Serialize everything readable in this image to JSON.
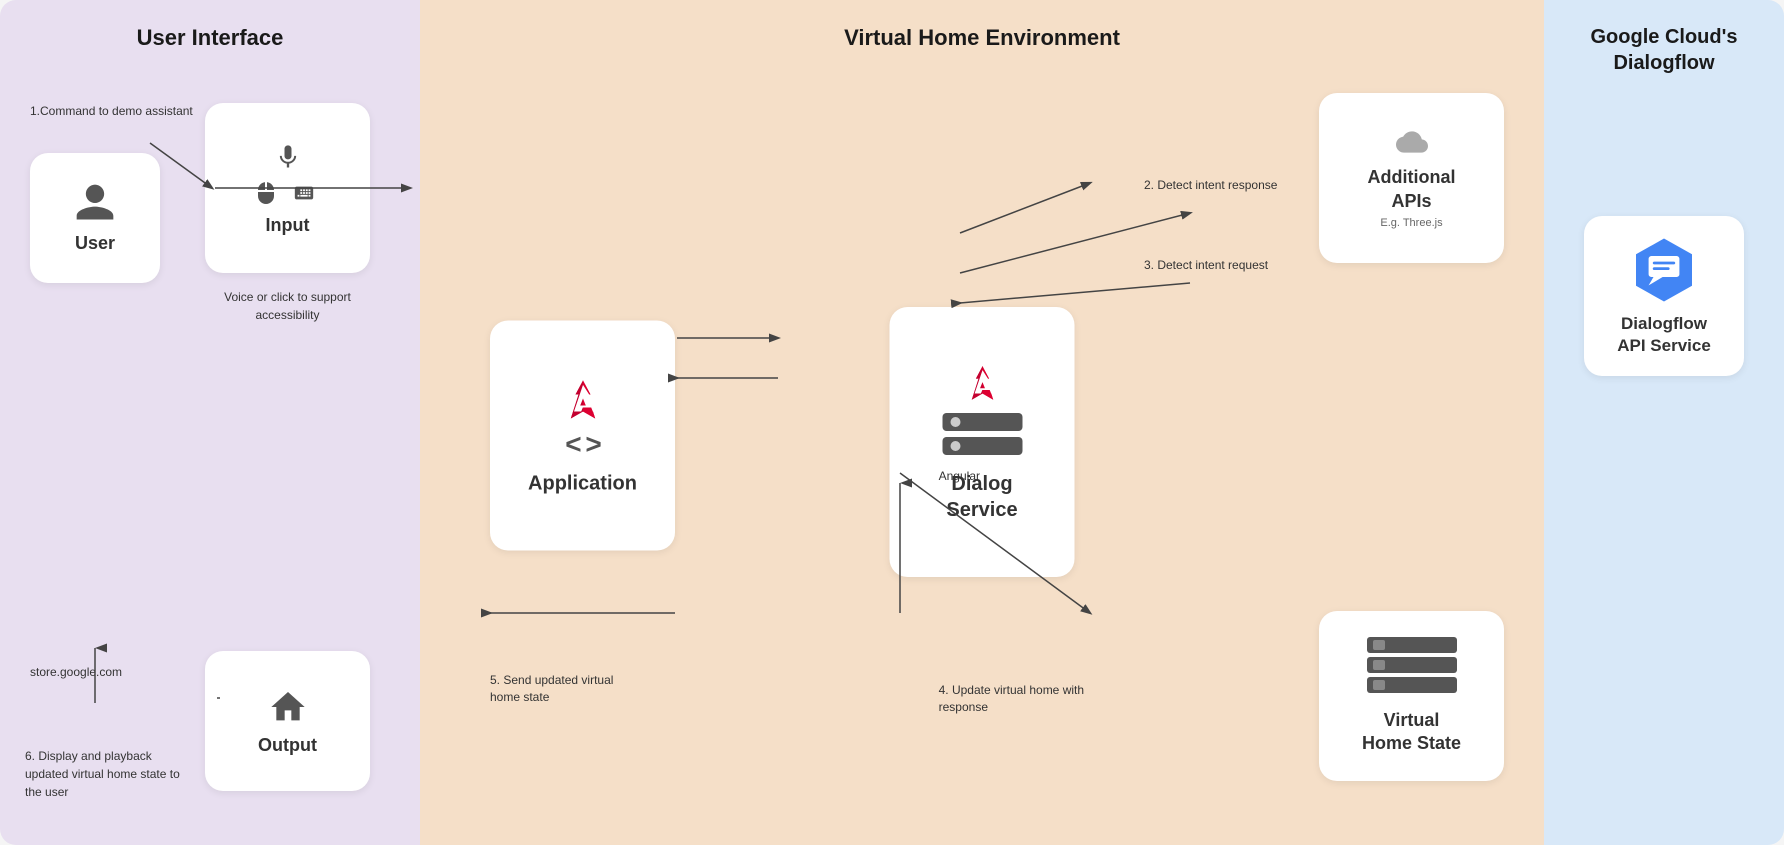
{
  "sections": {
    "ui": {
      "title": "User Interface",
      "user_label": "User",
      "input_label": "Input",
      "output_label": "Output",
      "input_description": "Voice or click to\nsupport accessibility",
      "command_text": "1.Command to demo\nassistant",
      "store_text": "store.google.com",
      "display_text": "6. Display and playback\nupdated virtual home\nstate to the user"
    },
    "vhe": {
      "title": "Virtual Home Environment",
      "application_label": "Application",
      "dialog_service_label": "Dialog\nService",
      "additional_apis_label": "Additional\nAPIs",
      "additional_apis_sub": "E.g. Three.js",
      "virtual_home_label": "Virtual\nHome State",
      "angular_label": "Angular",
      "arrow2_text": "2. Detect intent response",
      "arrow3_text": "3. Detect intent request",
      "arrow4_text": "4. Update virtual home\nwith response",
      "arrow5_text": "5. Send updated virtual\nhome state"
    },
    "gcloud": {
      "title": "Google Cloud's\nDialogflow",
      "dialogflow_label": "Dialogflow\nAPI Service"
    }
  },
  "colors": {
    "ui_bg": "#e8dff0",
    "vhe_bg": "#f5dfc8",
    "gcloud_bg": "#d8e8f8",
    "angular_red": "#dd0031",
    "arrow_color": "#444444",
    "box_white": "#ffffff"
  }
}
